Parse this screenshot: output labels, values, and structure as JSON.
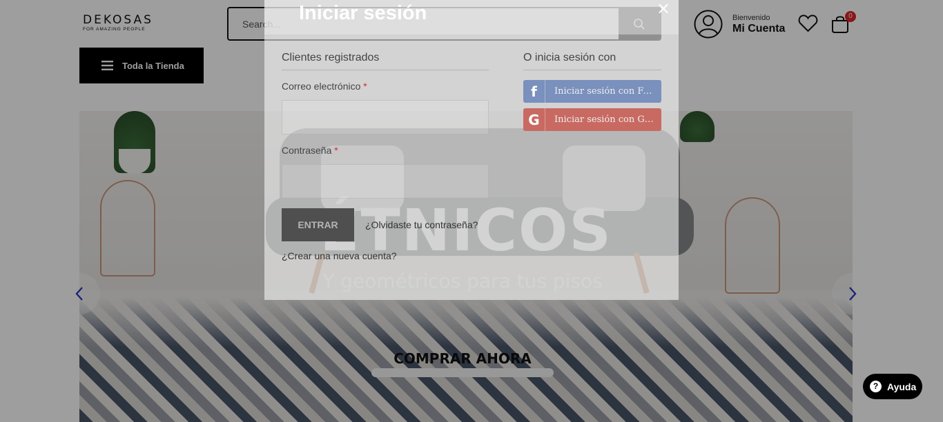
{
  "header": {
    "logo_main": "DEKOSAS",
    "logo_sub": "FOR AMAZING PEOPLE",
    "search_placeholder": "Search...",
    "account_greeting": "Bienvenido",
    "account_label": "Mi Cuenta",
    "cart_count": "0",
    "store_button": "Toda la Tienda"
  },
  "banner": {
    "title": "ÉTNICOS",
    "subtitle": "Y geométricos para tus pisos",
    "cta": "COMPRAR AHORA"
  },
  "login_modal": {
    "title": "Iniciar sesión",
    "close_symbol": "×",
    "registered_title": "Clientes registrados",
    "email_label": "Correo electrónico",
    "password_label": "Contraseña",
    "required_mark": "*",
    "enter_button": "ENTRAR",
    "forgot_link": "¿Olvidaste tu contraseña?",
    "create_link": "¿Crear una nueva cuenta?",
    "social_title": "O inicia sesión con",
    "facebook_button": "Iniciar sesión con Facebook",
    "google_button": "Iniciar sesión con Google"
  },
  "help": {
    "label": "Ayuda"
  },
  "colors": {
    "accent": "#000000",
    "badge": "#e02424",
    "facebook": "#7a90bd",
    "google": "#c86a62",
    "arrow": "#2f3bbf"
  },
  "icons": [
    "search-icon",
    "user-icon",
    "heart-icon",
    "cart-icon",
    "menu-icon",
    "chevron-left-icon",
    "chevron-right-icon",
    "facebook-icon",
    "google-icon",
    "help-icon",
    "close-icon"
  ]
}
